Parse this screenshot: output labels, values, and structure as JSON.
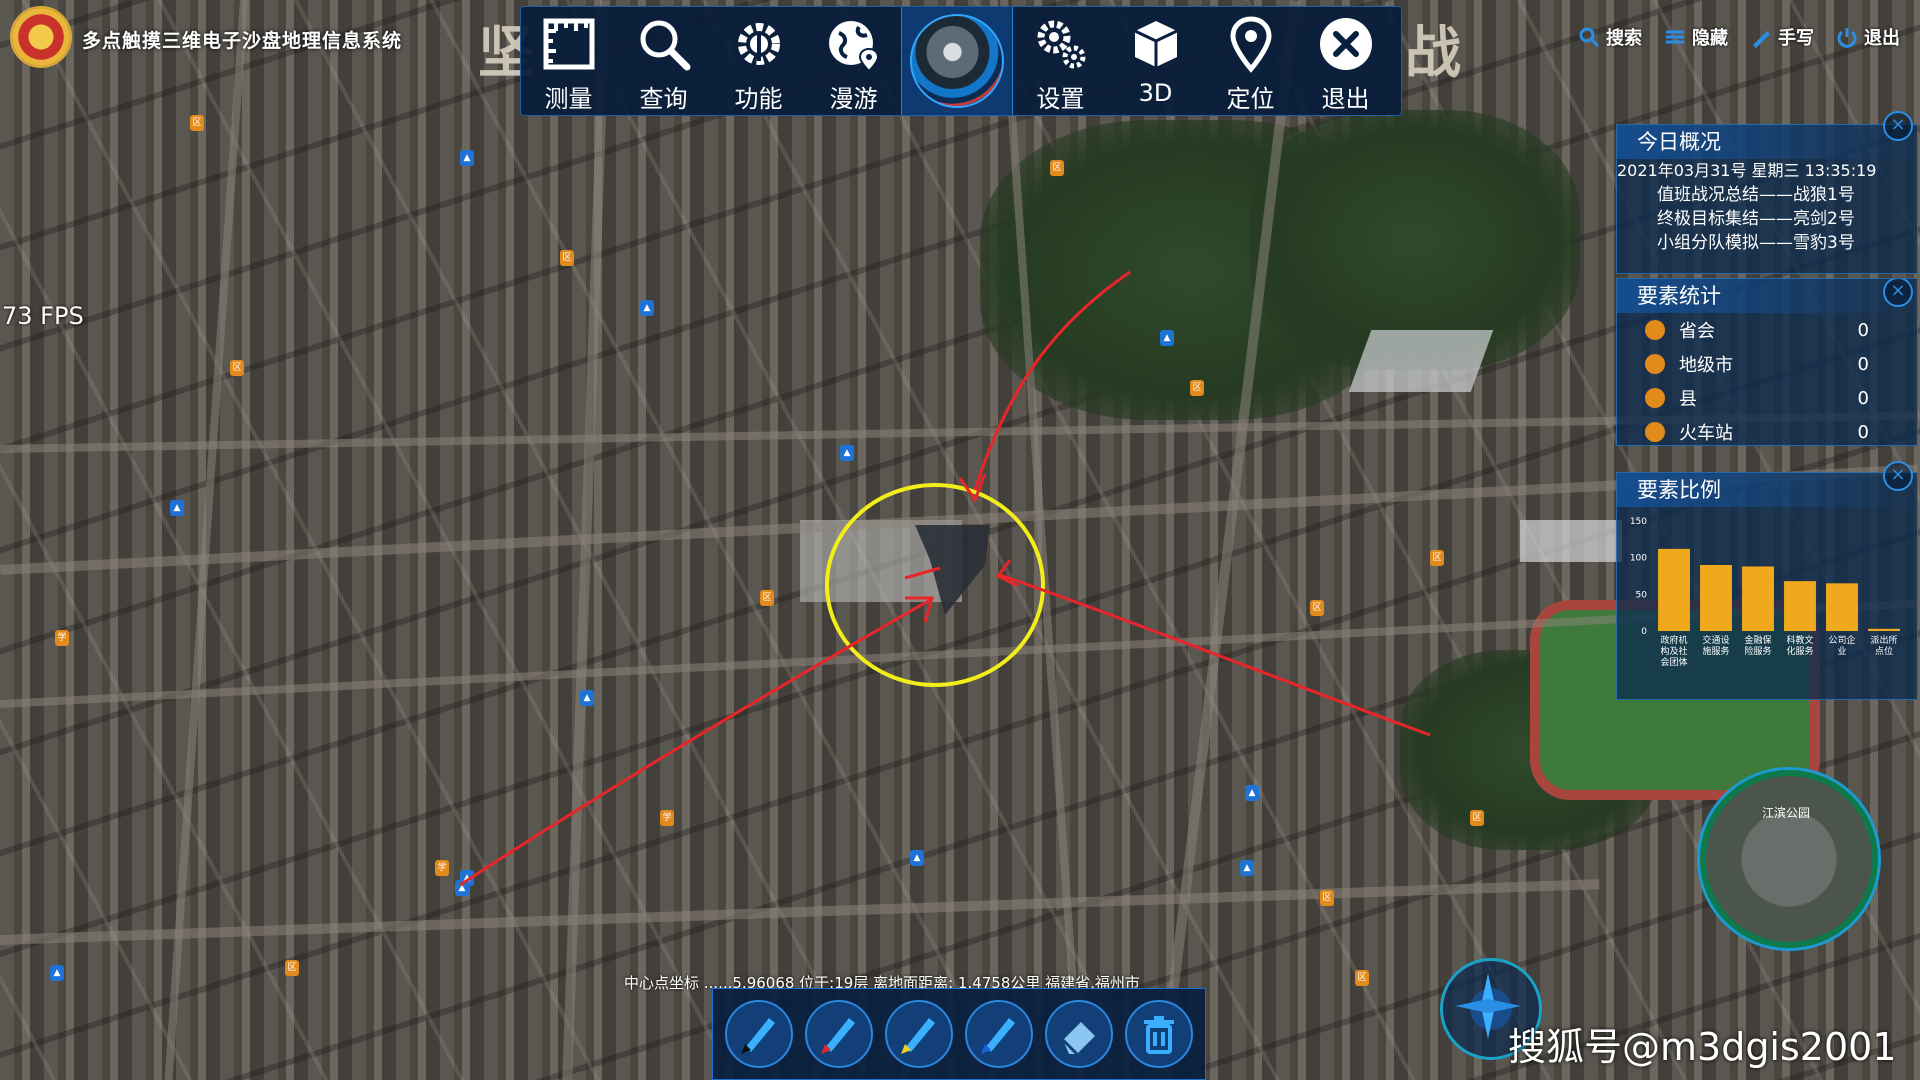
{
  "app": {
    "title": "多点触摸三维电子沙盘地理信息系统"
  },
  "background_text": {
    "left": "坚",
    "right": "战"
  },
  "toolbar": [
    {
      "label": "测量",
      "icon": "ruler-icon"
    },
    {
      "label": "查询",
      "icon": "search-icon"
    },
    {
      "label": "功能",
      "icon": "gear-wrench-icon"
    },
    {
      "label": "漫游",
      "icon": "globe-pin-icon"
    },
    {
      "label": "",
      "icon": "earth-globe-icon"
    },
    {
      "label": "设置",
      "icon": "gears-icon"
    },
    {
      "label": "3D",
      "icon": "cube-icon"
    },
    {
      "label": "定位",
      "icon": "location-pin-icon"
    },
    {
      "label": "退出",
      "icon": "close-circle-icon"
    }
  ],
  "top_right": {
    "search": "搜索",
    "hide": "隐藏",
    "handwrite": "手写",
    "exit": "退出"
  },
  "fps": "73 FPS",
  "today_panel": {
    "title": "今日概况",
    "datetime": "2021年03月31号 星期三 13:35:19",
    "rows": [
      "值班战况总结——战狼1号",
      "终极目标集结——亮剑2号",
      "小组分队模拟——雪豹3号"
    ]
  },
  "stats_panel": {
    "title": "要素统计",
    "rows": [
      {
        "label": "省会",
        "value": "0"
      },
      {
        "label": "地级市",
        "value": "0"
      },
      {
        "label": "县",
        "value": "0"
      },
      {
        "label": "火车站",
        "value": "0"
      }
    ]
  },
  "ratio_panel": {
    "title": "要素比例"
  },
  "chart_data": {
    "type": "bar",
    "title": "要素比例",
    "categories": [
      "政府机构及社会团体",
      "交通设施服务",
      "金融保险服务",
      "科教文化服务",
      "公司企业",
      "派出所点位"
    ],
    "tick_labels": [
      "政府机\n构及社\n会团体",
      "交通设\n施服务",
      "金融保\n险服务",
      "科教文\n化服务",
      "公司企\n业",
      "派出所\n点位"
    ],
    "values": [
      112,
      90,
      88,
      68,
      65,
      3
    ],
    "ylim": [
      0,
      150
    ],
    "yticks": [
      0,
      50,
      100,
      150
    ],
    "color": "#f0a81c"
  },
  "status_bar": {
    "text": "中心点坐标 ......5.96068 位于:19层 离地面距离: 1.4758公里 福建省,福州市"
  },
  "draw_tools": [
    {
      "icon": "pen-black-icon",
      "color": "#111111"
    },
    {
      "icon": "pen-red-icon",
      "color": "#e0252b"
    },
    {
      "icon": "pen-yellow-icon",
      "color": "#f2d21a"
    },
    {
      "icon": "pen-blue-icon",
      "color": "#1c5fe0"
    },
    {
      "icon": "eraser-icon",
      "color": "#8ac6f0"
    },
    {
      "icon": "trash-icon",
      "color": "#3ab0ff"
    }
  ],
  "watermark": "搜狐号@m3dgis2001",
  "minimap_label": "江滨公园",
  "colors": {
    "accent": "#2a8ee6",
    "panel_bg": "#0d2b50",
    "highlight_circle": "#f2ee1a",
    "annotation": "#e8262a"
  }
}
